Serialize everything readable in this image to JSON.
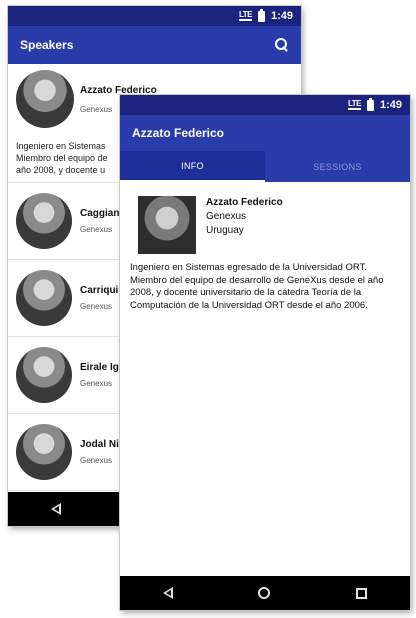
{
  "status": {
    "network": "LTE",
    "time": "1:49"
  },
  "list_screen": {
    "title": "Speakers",
    "featured": {
      "name": "Azzato Federico",
      "company": "Genexus",
      "description_lines": [
        "Ingeniero en Sistemas",
        "Miembro del equipo de",
        "año 2008, y docente u"
      ]
    },
    "speakers": [
      {
        "name": "Caggiano",
        "company": "Genexus"
      },
      {
        "name": "Carriquiri",
        "company": "Genexus"
      },
      {
        "name": "Eirale Igr",
        "company": "Genexus"
      },
      {
        "name": "Jodal Nic",
        "company": "Genexus"
      }
    ]
  },
  "detail_screen": {
    "title": "Azzato Federico",
    "tabs": [
      {
        "label": "INFO"
      },
      {
        "label": "SESSIONS"
      }
    ],
    "speaker": {
      "name": "Azzato Federico",
      "company": "Genexus",
      "country": "Uruguay",
      "bio": "Ingeniero en Sistemas egresado de la Universidad ORT. Miembro del equipo de desarrollo de GeneXus desde el año 2008, y docente universitario de la cátedra Teoría de la Computación de la Universidad ORT desde el año 2006."
    }
  },
  "icons": {
    "search": "search-icon",
    "back": "back-icon",
    "home": "home-icon",
    "recent": "recent-apps-icon"
  },
  "colors": {
    "primary": "#2a3baa",
    "status_bar": "#1a237e",
    "nav_bar": "#000000"
  }
}
